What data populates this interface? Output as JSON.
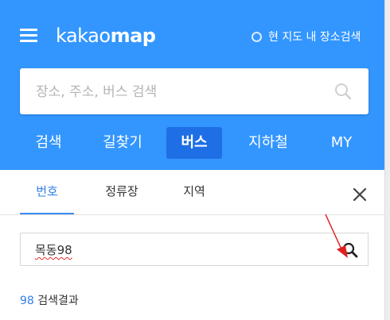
{
  "header": {
    "logo_light": "kakao",
    "logo_bold": "map",
    "nearby_label": "현 지도 내 장소검색",
    "bg_color": "#3396ff"
  },
  "search": {
    "placeholder": "장소, 주소, 버스 검색",
    "icon": "search-icon"
  },
  "nav": {
    "tabs": [
      {
        "label": "검색"
      },
      {
        "label": "길찾기"
      },
      {
        "label": "버스",
        "active": true
      },
      {
        "label": "지하철"
      },
      {
        "label": "MY"
      }
    ],
    "active_color": "#1e6fe6"
  },
  "subtabs": {
    "items": [
      {
        "label": "번호",
        "active": true
      },
      {
        "label": "정류장"
      },
      {
        "label": "지역"
      }
    ],
    "close_icon": "close-icon"
  },
  "bus_search": {
    "value": "목동98",
    "icon": "search-icon"
  },
  "result": {
    "count": "98",
    "label": " 검색결과"
  }
}
